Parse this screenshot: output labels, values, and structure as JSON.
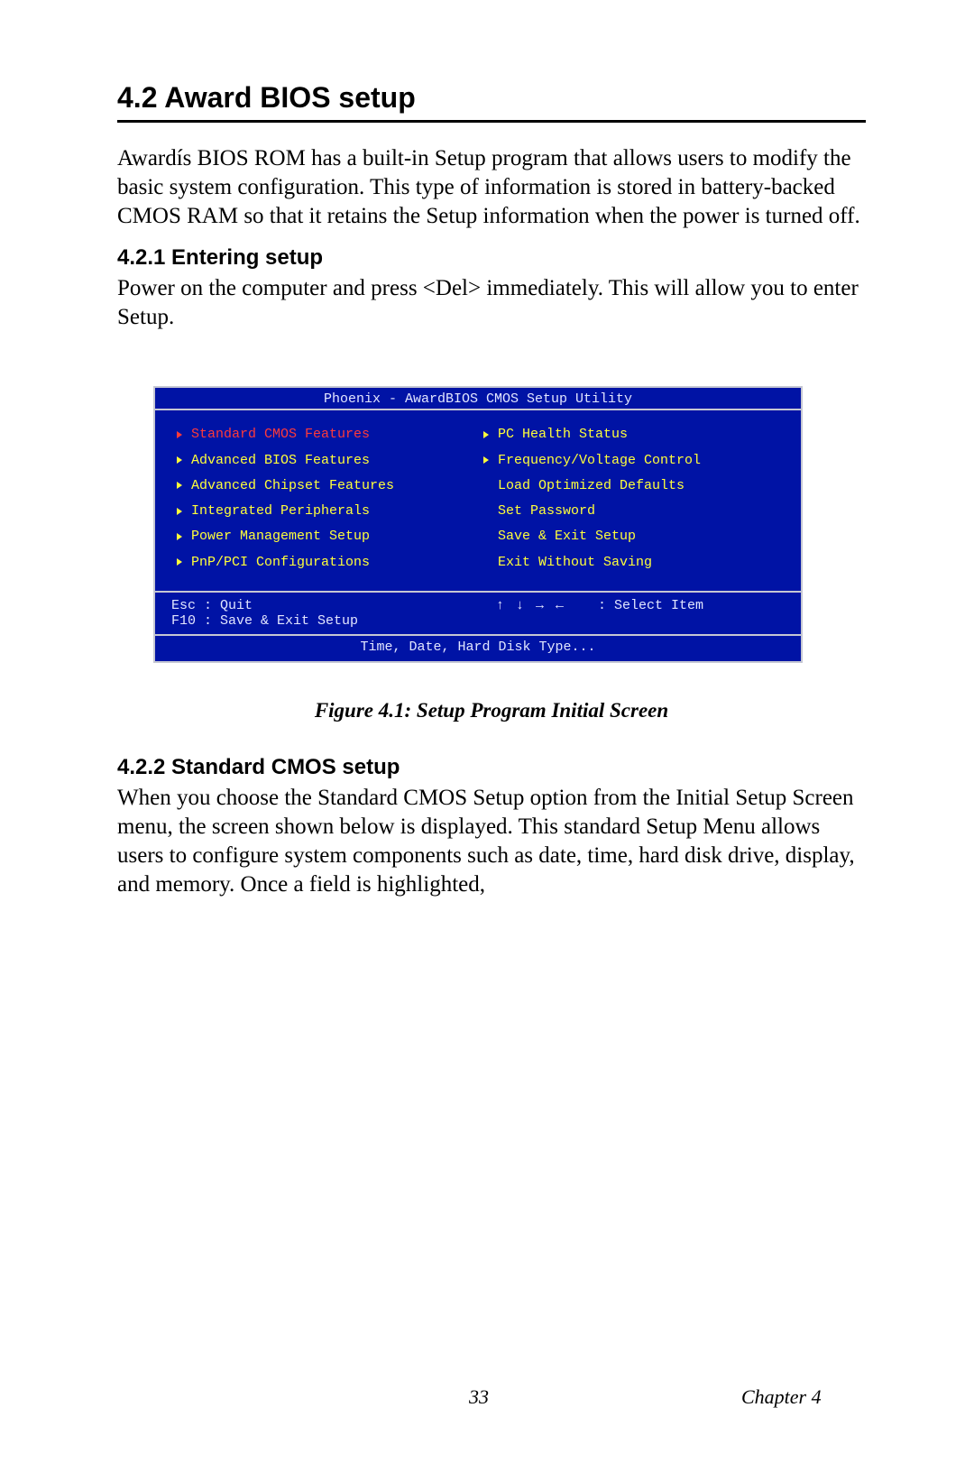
{
  "section": {
    "number": "4.2",
    "title_full": "4.2  Award BIOS setup",
    "paragraph1": "Awardís BIOS ROM has a built-in Setup program that allows users to modify the basic system configuration. This type of information is stored in battery-backed CMOS RAM so that it retains the Setup information when the power is turned off."
  },
  "sub1": {
    "heading": "4.2.1 Entering setup",
    "paragraph": "Power on the computer and press <Del> immediately. This will allow you to enter Setup."
  },
  "bios": {
    "title": "Phoenix - AwardBIOS CMOS Setup Utility",
    "left_items": [
      {
        "label": "Standard CMOS Features",
        "arrow": true,
        "selected": true
      },
      {
        "label": "Advanced BIOS Features",
        "arrow": true,
        "selected": false
      },
      {
        "label": "Advanced Chipset Features",
        "arrow": true,
        "selected": false
      },
      {
        "label": "Integrated Peripherals",
        "arrow": true,
        "selected": false
      },
      {
        "label": "Power Management Setup",
        "arrow": true,
        "selected": false
      },
      {
        "label": "PnP/PCI Configurations",
        "arrow": true,
        "selected": false
      }
    ],
    "right_items": [
      {
        "label": "PC Health Status",
        "arrow": true,
        "selected": false
      },
      {
        "label": "Frequency/Voltage Control",
        "arrow": true,
        "selected": false
      },
      {
        "label": "Load Optimized Defaults",
        "arrow": false,
        "selected": false
      },
      {
        "label": "Set Password",
        "arrow": false,
        "selected": false
      },
      {
        "label": "Save & Exit Setup",
        "arrow": false,
        "selected": false
      },
      {
        "label": "Exit Without Saving",
        "arrow": false,
        "selected": false
      }
    ],
    "footer": {
      "esc": "Esc : Quit",
      "f10": "F10 : Save & Exit Setup",
      "arrows": "↑ ↓ → ←",
      "select": ": Select Item",
      "hint": "Time, Date, Hard Disk Type..."
    }
  },
  "figure_caption": "Figure 4.1: Setup Program Initial Screen",
  "sub2": {
    "heading": "4.2.2 Standard CMOS setup",
    "paragraph": "When you choose the Standard CMOS Setup option from the Initial Setup Screen menu, the screen shown below is displayed. This standard Setup Menu allows users to configure system components such as date, time, hard disk drive, display, and memory. Once a field is highlighted,"
  },
  "page_footer": {
    "page_number": "33",
    "chapter": "Chapter 4"
  }
}
